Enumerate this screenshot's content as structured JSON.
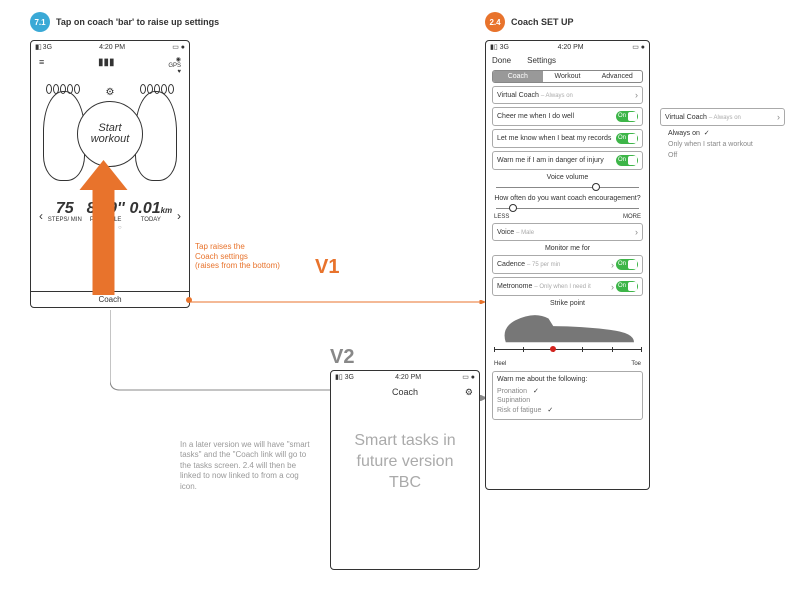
{
  "section71": {
    "badge": "7.1",
    "title": "Tap on coach 'bar' to raise up settings"
  },
  "section24": {
    "badge": "2.4",
    "title": "Coach SET UP"
  },
  "status": {
    "signal": "3G",
    "time": "4:20 PM"
  },
  "phone1": {
    "start_line1": "Start",
    "start_line2": "workout",
    "m1_big": "75",
    "m1_small": "STEPS/ MIN",
    "m2_big": "8'40''",
    "m2_small": "PACE/MILE",
    "m3_big": "0.01",
    "m3_unit": "km",
    "m3_small": "TODAY",
    "gps": "GPS",
    "coach": "Coach"
  },
  "annot1": "Tap raises the\nCoach settings\n(raises from the bottom)",
  "v1": "V1",
  "v2": "V2",
  "note_v2": "In a later version we will have \"smart tasks\" and the \"Coach link will go to the tasks screen. 2.4 will then be linked to now linked to from a cog icon.",
  "phone2": {
    "title": "Coach",
    "placeholder": "Smart tasks in future version TBC"
  },
  "phone3": {
    "done": "Done",
    "title": "Settings",
    "tabs": [
      "Coach",
      "Workout",
      "Advanced"
    ],
    "vc_label": "Virtual Coach",
    "vc_value": "Always on",
    "cheer": "Cheer me when I do well",
    "records": "Let me know when I beat my records",
    "injury": "Warn me if I am in danger of injury",
    "voice_vol": "Voice volume",
    "encourage_q": "How often do you want coach encouragement?",
    "less": "LESS",
    "more": "MORE",
    "voice_lbl": "Voice",
    "voice_val": "Male",
    "monitor": "Monitor me for",
    "cadence_lbl": "Cadence",
    "cadence_val": "75 per min",
    "metro_lbl": "Metronome",
    "metro_val": "Only when I need it",
    "strike": "Strike point",
    "heel": "Heel",
    "toe": "Toe",
    "warn_hdr": "Warn me about the following:",
    "warn1": "Pronation",
    "warn2": "Supination",
    "warn3": "Risk of fatigue"
  },
  "popover": {
    "label": "Virtual Coach",
    "value": "Always on",
    "opt1": "Always on",
    "opt2": "Only when I start a workout",
    "opt3": "Off"
  }
}
